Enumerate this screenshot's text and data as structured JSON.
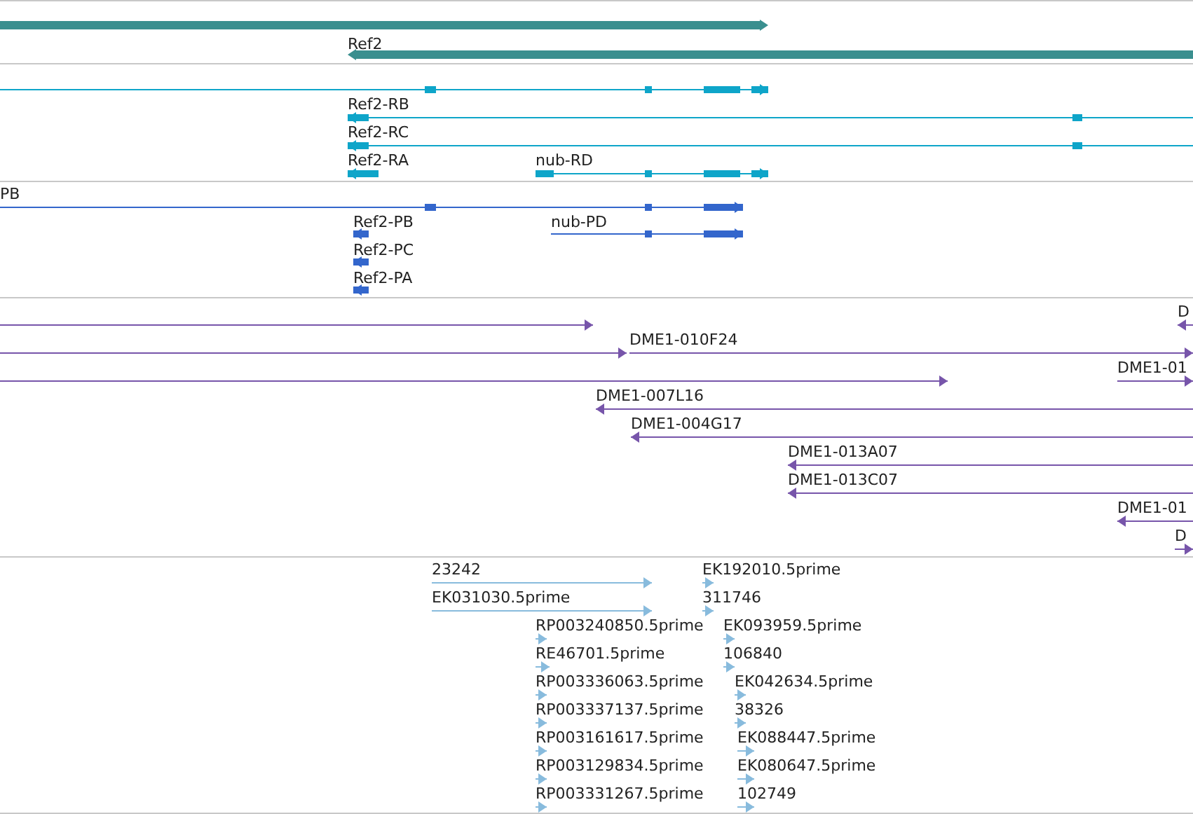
{
  "tracks": [
    {
      "kind": "gene",
      "features": [
        {
          "reverse": false
        },
        {
          "label": "Ref2",
          "reverse": true
        }
      ]
    },
    {
      "kind": "transcript",
      "features": [
        {
          "reverse": false
        },
        {
          "label": "Ref2-RB",
          "reverse": true
        },
        {
          "label": "Ref2-RC",
          "reverse": true
        },
        {
          "label": "Ref2-RA",
          "reverse": true
        },
        {
          "label": "nub-RD",
          "reverse": false
        }
      ]
    },
    {
      "kind": "protein",
      "features": [
        {
          "label": "PB",
          "reverse": false
        },
        {
          "label": "Ref2-PB",
          "reverse": true
        },
        {
          "label": "nub-PD",
          "reverse": false
        },
        {
          "label": "Ref2-PC",
          "reverse": true
        },
        {
          "label": "Ref2-PA",
          "reverse": true
        }
      ]
    },
    {
      "kind": "clone",
      "features": [
        {
          "reverse": false
        },
        {
          "label": "D",
          "reverse": true
        },
        {
          "reverse": false
        },
        {
          "label": "DME1-010F24",
          "reverse": false
        },
        {
          "reverse": false
        },
        {
          "label": "DME1-01",
          "reverse": false
        },
        {
          "label": "DME1-007L16",
          "reverse": true
        },
        {
          "label": "DME1-004G17",
          "reverse": true
        },
        {
          "label": "DME1-013A07",
          "reverse": true
        },
        {
          "label": "DME1-013C07",
          "reverse": true
        },
        {
          "label": "DME1-01",
          "reverse": true
        },
        {
          "label": "D",
          "reverse": false
        }
      ]
    },
    {
      "kind": "est",
      "features": [
        {
          "label": "23242",
          "reverse": false
        },
        {
          "label": "EK031030.5prime",
          "reverse": false
        },
        {
          "label": "EK192010.5prime",
          "reverse": false
        },
        {
          "label": "311746",
          "reverse": false
        },
        {
          "label": "RP003240850.5prime",
          "reverse": false
        },
        {
          "label": "EK093959.5prime",
          "reverse": false
        },
        {
          "label": "RE46701.5prime",
          "reverse": false
        },
        {
          "label": "106840",
          "reverse": false
        },
        {
          "label": "RP003336063.5prime",
          "reverse": false
        },
        {
          "label": "EK042634.5prime",
          "reverse": false
        },
        {
          "label": "RP003337137.5prime",
          "reverse": false
        },
        {
          "label": "38326",
          "reverse": false
        },
        {
          "label": "RP003161617.5prime",
          "reverse": false
        },
        {
          "label": "EK088447.5prime",
          "reverse": false
        },
        {
          "label": "RP003129834.5prime",
          "reverse": false
        },
        {
          "label": "EK080647.5prime",
          "reverse": false
        },
        {
          "label": "RP003331267.5prime",
          "reverse": false
        },
        {
          "label": "102749",
          "reverse": false
        }
      ]
    }
  ]
}
